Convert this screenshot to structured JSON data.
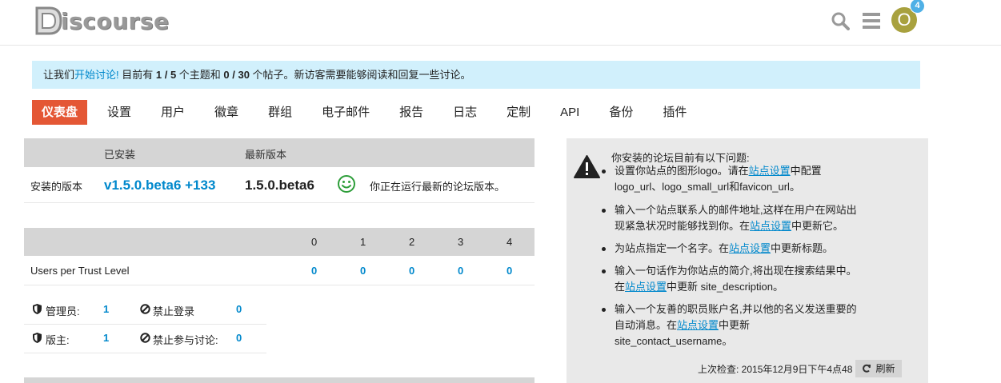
{
  "header": {
    "logo_text": "iscourse",
    "logo_letter": "D",
    "notification_count": "4",
    "avatar_letter": "O"
  },
  "banner": {
    "part1": "让我们",
    "link": "开始讨论!",
    "part2": " 目前有 ",
    "topics": "1 / 5",
    "part3": " 个主题和 ",
    "posts": "0 / 30",
    "part4": " 个帖子。新访客需要能够阅读和回复一些讨论。"
  },
  "nav": {
    "items": [
      "仪表盘",
      "设置",
      "用户",
      "徽章",
      "群组",
      "电子邮件",
      "报告",
      "日志",
      "定制",
      "API",
      "备份",
      "插件"
    ]
  },
  "version": {
    "installed_header": "已安装",
    "latest_header": "最新版本",
    "row_label": "安装的版本",
    "installed_value": "v1.5.0.beta6 +133",
    "latest_value": "1.5.0.beta6",
    "status_text": "你正在运行最新的论坛版本。"
  },
  "trust": {
    "levels": [
      "0",
      "1",
      "2",
      "3",
      "4"
    ],
    "row_label": "Users per Trust Level",
    "values": [
      "0",
      "0",
      "0",
      "0",
      "0"
    ]
  },
  "staff": {
    "admins_label": "管理员:",
    "admins_value": "1",
    "banned_label": "禁止登录",
    "banned_value": "0",
    "moderators_label": "版主:",
    "moderators_value": "1",
    "suspended_label": "禁止参与讨论:",
    "suspended_value": "0"
  },
  "issues": {
    "title": "你安装的论坛目前有以下问题:",
    "link_text": "站点设置",
    "i1a": "设置你站点的图形logo。请在",
    "i1b": "中配置",
    "i1c": "logo_url、logo_small_url和favicon_url。",
    "i2a": "输入一个站点联系人的邮件地址,这样在用户在网站出",
    "i2b": "现紧急状况时能够找到你。在",
    "i2c": "中更新它。",
    "i3a": "为站点指定一个名字。在",
    "i3b": "中更新标题。",
    "i4a": "输入一句话作为你站点的简介,将出现在搜索结果中。",
    "i4b": "在",
    "i4c": "中更新 site_description。",
    "i5a": "输入一个友善的职员账户名,并以他的名义发送重要的",
    "i5b": "自动消息。在",
    "i5c": "中更新",
    "i5d": "site_contact_username。",
    "last_checked": "上次检查: 2015年12月9日下午4点48",
    "refresh": "刷新"
  },
  "colors": {
    "accent": "#e45735",
    "link": "#0088cc",
    "banner_bg": "#d1f0fc",
    "ok_green": "#2e9e3a",
    "avatar": "#a8a13e",
    "badge": "#4fb0e6"
  }
}
